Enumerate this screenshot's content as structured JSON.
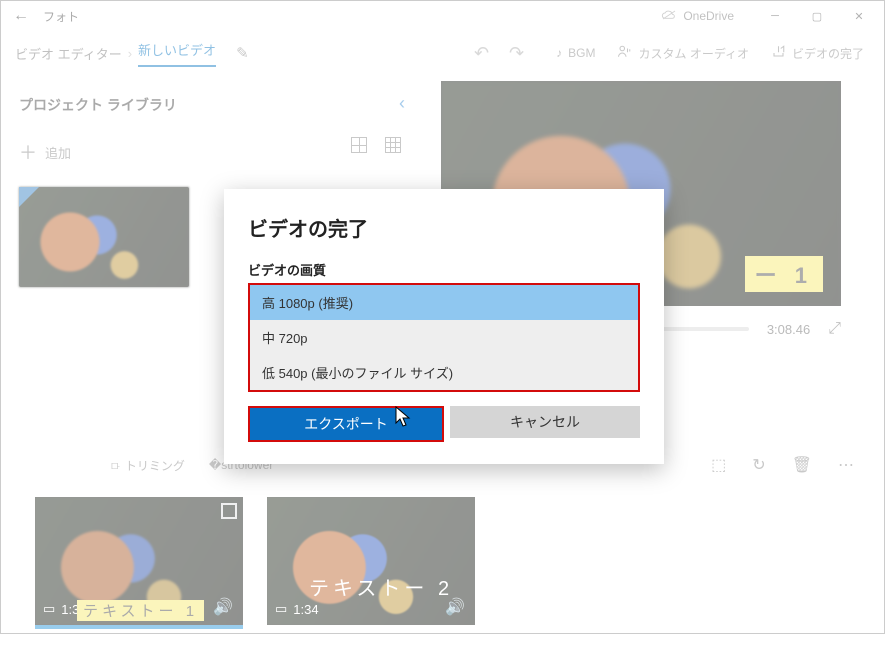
{
  "titlebar": {
    "app": "フォト",
    "onedrive": "OneDrive"
  },
  "topbar": {
    "crumb1": "ビデオ エディター",
    "crumb2": "新しいビデオ",
    "bgm": "BGM",
    "custom_audio": "カスタム オーディオ",
    "finish": "ビデオの完了"
  },
  "library": {
    "title": "プロジェクト ライブラリ",
    "add": "追加"
  },
  "preview": {
    "marker": "ー 1",
    "time": "3:08.46"
  },
  "tools": {
    "trim": "トリミング"
  },
  "clips": {
    "t1": "1:34",
    "badge1": "テキストー 1",
    "t2": "1:34",
    "label2": "テキストー 2"
  },
  "dialog": {
    "title": "ビデオの完了",
    "subtitle": "ビデオの画質",
    "opt_high": "高 1080p (推奨)",
    "opt_med": "中 720p",
    "opt_low": "低 540p (最小のファイル サイズ)",
    "export": "エクスポート",
    "cancel": "キャンセル"
  }
}
